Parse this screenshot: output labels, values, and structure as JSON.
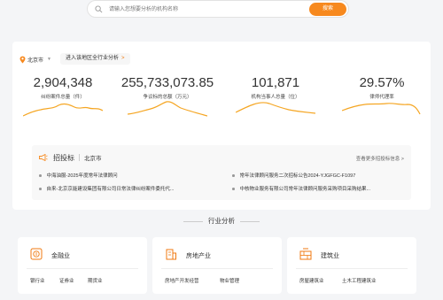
{
  "search": {
    "placeholder": "请输入您想要分析的机构名称",
    "button_label": "搜索"
  },
  "region": {
    "label": "北京市",
    "enter_report_label": "进入该地区全行业分析",
    "arrow": ">"
  },
  "stats": [
    {
      "value": "2,904,348",
      "label": "纠纷案件总量（件）"
    },
    {
      "value": "255,733,073.85",
      "label": "争议标的总额（万元）"
    },
    {
      "value": "101,871",
      "label": "机构当事人总量（位）"
    },
    {
      "value": "29.57%",
      "label": "律师代理率"
    }
  ],
  "bidding": {
    "title": "招投标",
    "region": "北京市",
    "more_label": "查看更多招投标信息",
    "more_arrow": ">",
    "items": [
      "中海油服-2025年度常年法律顾问",
      "常年法律顾问服务二次招标公告2024-YJGFGC-F1097",
      "自来-北京京能建设集团有限公司日常法律纠纷案件委托代...",
      "中核物业服务有限公司常年法律顾问服务采购项目采购结果..."
    ]
  },
  "industry": {
    "title": "行业分析",
    "cards": [
      {
        "name": "金融业",
        "icon": "finance-icon",
        "subs": [
          "银行业",
          "证券业",
          "期货业"
        ]
      },
      {
        "name": "房地产业",
        "icon": "building-icon",
        "subs": [
          "房地产开发经营",
          "物业管理"
        ]
      },
      {
        "name": "建筑业",
        "icon": "construction-icon",
        "subs": [
          "房屋建筑业",
          "土木工程建筑业"
        ]
      }
    ]
  },
  "colors": {
    "accent": "#f7891e",
    "spark": "#f5a623"
  }
}
